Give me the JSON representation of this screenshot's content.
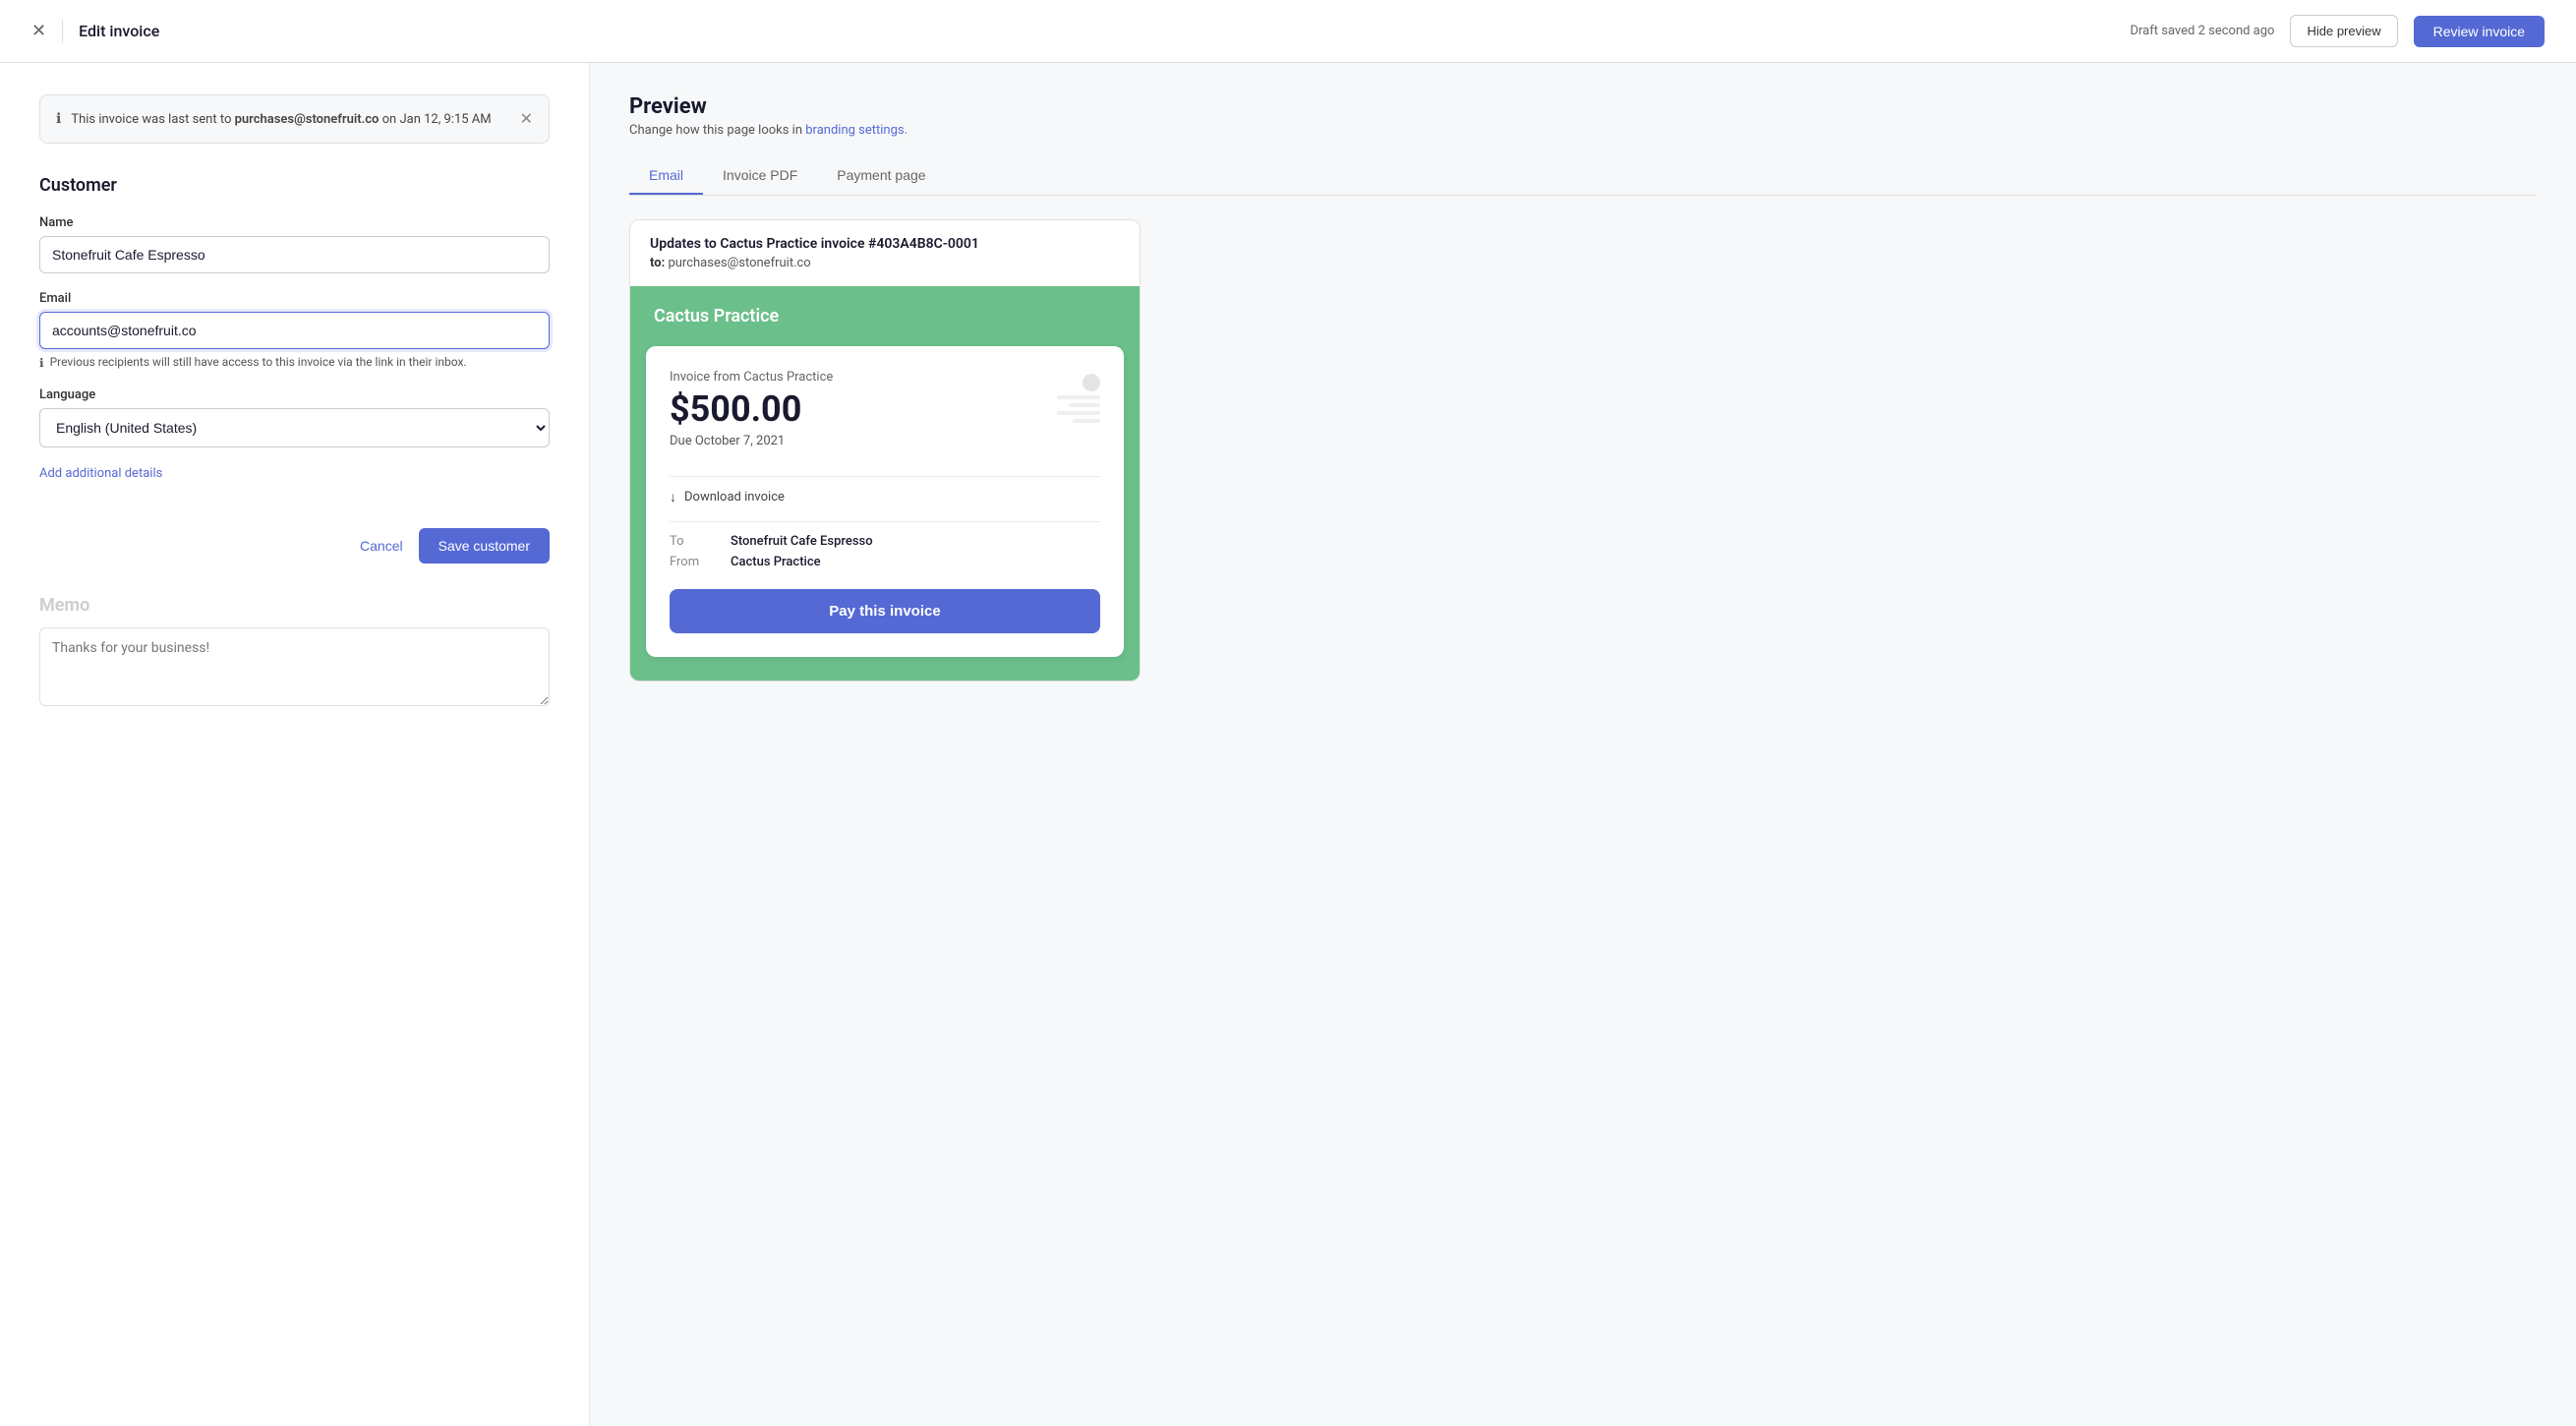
{
  "header": {
    "title": "Edit invoice",
    "draft_status": "Draft saved 2 second ago",
    "hide_preview_label": "Hide preview",
    "review_invoice_label": "Review invoice"
  },
  "banner": {
    "message_prefix": "This invoice was last sent to",
    "email": "purchases@stonefruit.co",
    "message_suffix": "on Jan 12, 9:15 AM"
  },
  "customer": {
    "section_title": "Customer",
    "name_label": "Name",
    "name_value": "Stonefruit Cafe Espresso",
    "email_label": "Email",
    "email_value": "accounts@stonefruit.co",
    "email_helper": "Previous recipients will still have access to this invoice via the link in their inbox.",
    "language_label": "Language",
    "language_value": "English (United States)",
    "add_details_label": "Add additional details",
    "cancel_label": "Cancel",
    "save_label": "Save customer"
  },
  "memo": {
    "section_title": "Memo",
    "placeholder": "Thanks for your business!"
  },
  "preview": {
    "title": "Preview",
    "subtitle": "Change how this page looks in",
    "branding_link": "branding settings.",
    "tabs": [
      "Email",
      "Invoice PDF",
      "Payment page"
    ],
    "active_tab": "Email",
    "email": {
      "subject": "Updates to Cactus Practice invoice #403A4B8C-0001",
      "to_label": "to:",
      "to_email": "purchases@stonefruit.co",
      "brand_name": "Cactus Practice",
      "invoice_from": "Invoice from Cactus Practice",
      "amount": "$500.00",
      "due_date": "Due October 7, 2021",
      "download_label": "Download invoice",
      "to_label2": "To",
      "to_value": "Stonefruit Cafe Espresso",
      "from_label": "From",
      "from_value": "Cactus Practice",
      "pay_button": "Pay this invoice"
    }
  }
}
